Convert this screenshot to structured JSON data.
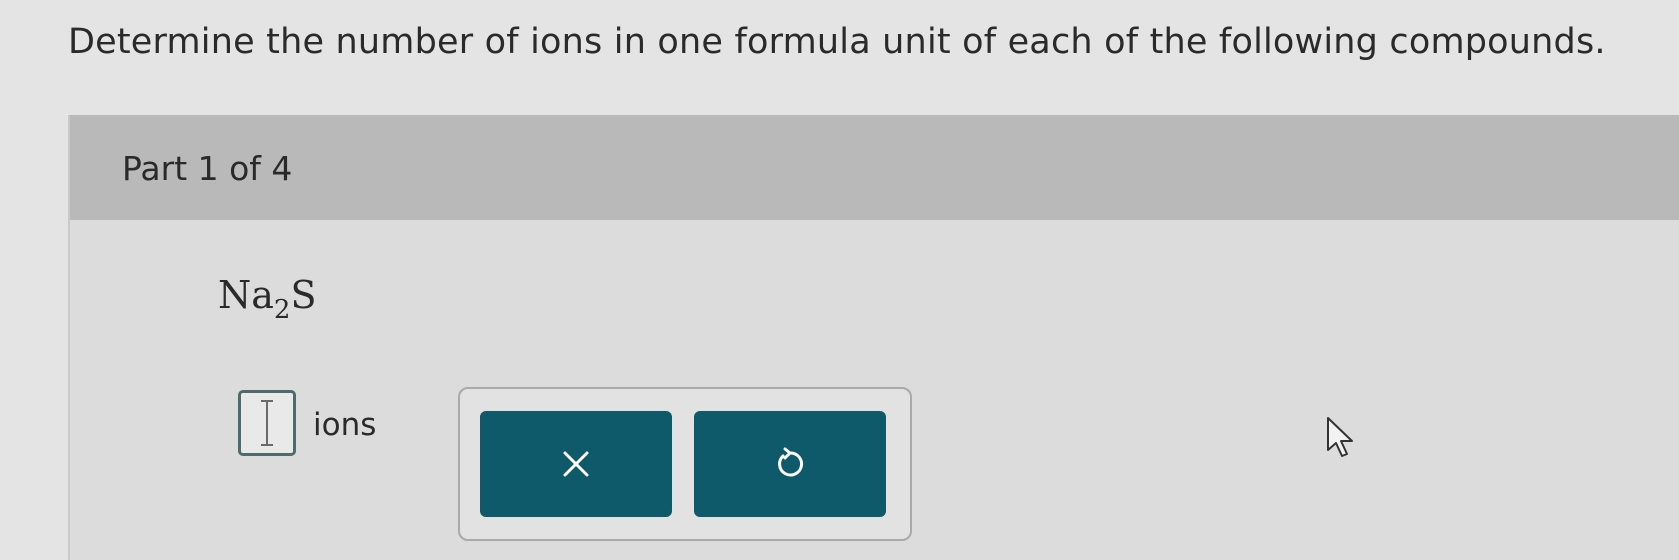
{
  "question": {
    "text": "Determine the number of ions in one formula unit of each of the following compounds."
  },
  "part": {
    "label": "Part 1 of 4",
    "compound": {
      "element": "Na",
      "subscript": "2",
      "anion": "S"
    },
    "answer": {
      "value": "",
      "unit": "ions"
    },
    "actions": {
      "clear_icon": "x-icon",
      "undo_icon": "undo-icon",
      "button_color": "#0f5a6a"
    }
  },
  "icons": {
    "text_cursor": "text-cursor-icon",
    "mouse_pointer": "mouse-pointer-icon"
  }
}
